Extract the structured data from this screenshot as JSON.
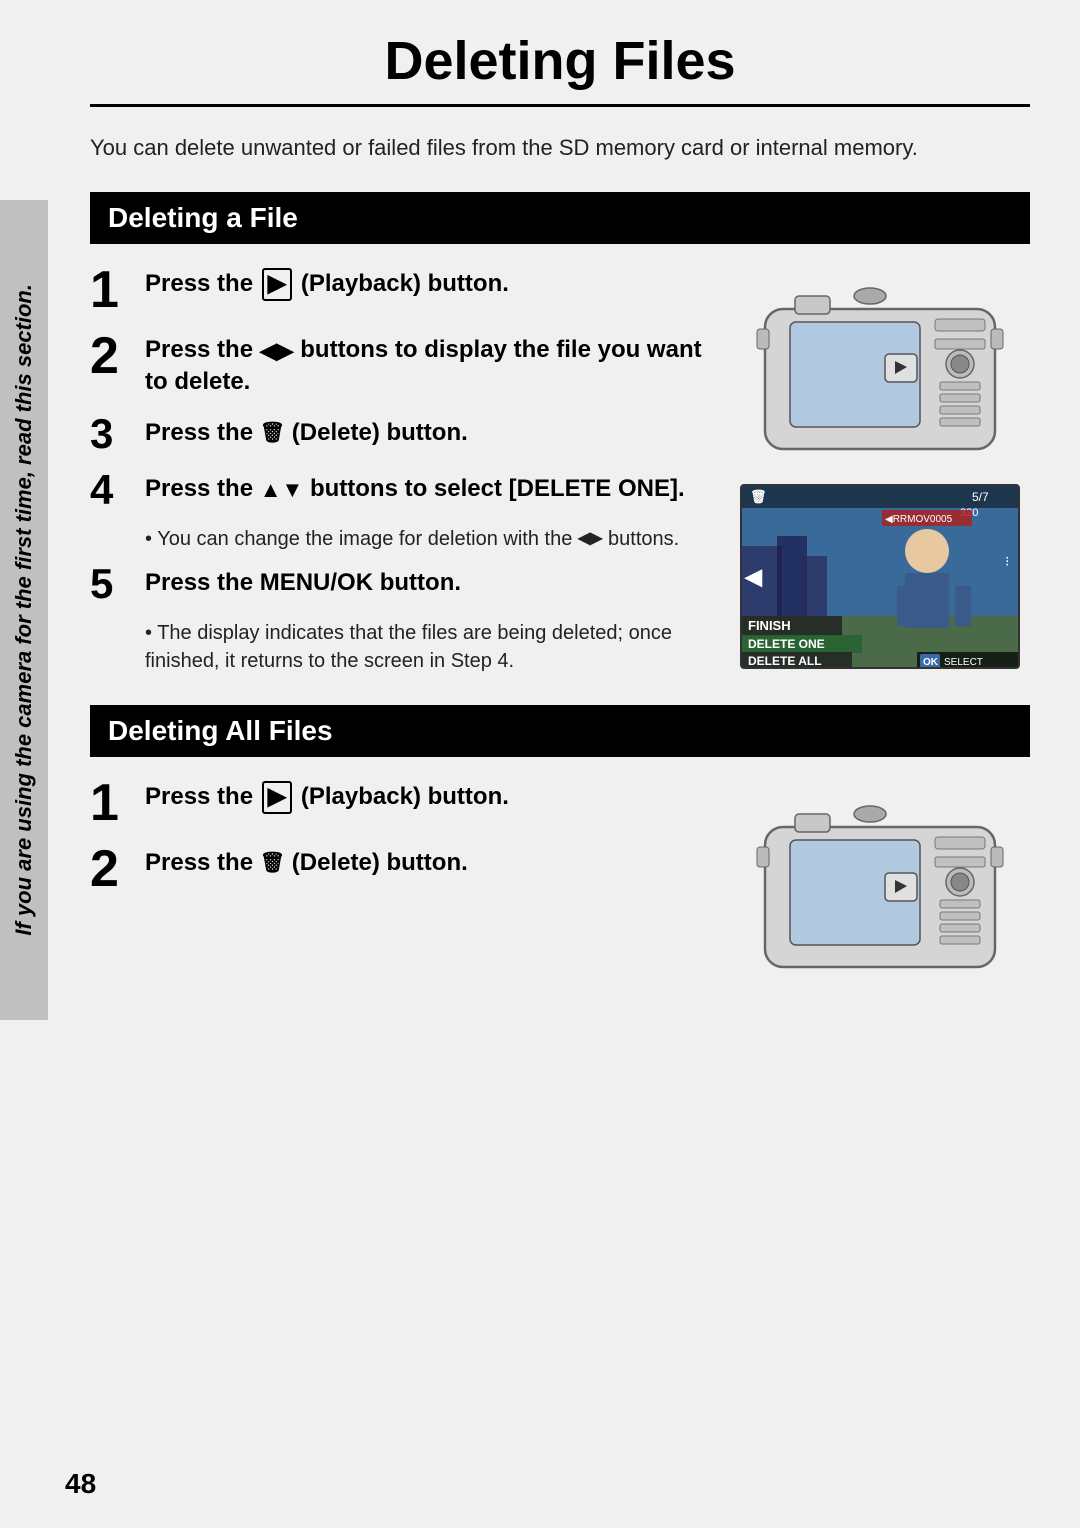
{
  "page": {
    "title": "Deleting Files",
    "page_number": "48",
    "intro": "You can delete unwanted or failed files from the SD memory card or internal memory.",
    "side_tab": "If you are using the camera for the first time, read this section.",
    "section1": {
      "header": "Deleting a File",
      "steps": [
        {
          "num": "1",
          "text": "Press the  (Playback) button."
        },
        {
          "num": "2",
          "text": "Press the  buttons to display the file you want to delete."
        },
        {
          "num": "3",
          "text": "Press the  (Delete) button."
        },
        {
          "num": "4",
          "text": "Press the  buttons to select [DELETE ONE].",
          "bullet": "You can change the image for deletion with the  buttons."
        },
        {
          "num": "5",
          "text": "Press the MENU/OK button.",
          "bullet": "The display indicates that the files are being deleted; once finished, it returns to the screen in Step 4."
        }
      ]
    },
    "section2": {
      "header": "Deleting All Files",
      "steps": [
        {
          "num": "1",
          "text": "Press the  (Playback) button."
        },
        {
          "num": "2",
          "text": "Press the  (Delete) button."
        }
      ]
    },
    "delete_menu": {
      "items": [
        "FINISH",
        "DELETE ONE",
        "DELETE ALL"
      ],
      "ok_label": "OK SELECT",
      "file_num": "5/7",
      "file_name": "RRMOV0005",
      "resolution": "320"
    }
  }
}
